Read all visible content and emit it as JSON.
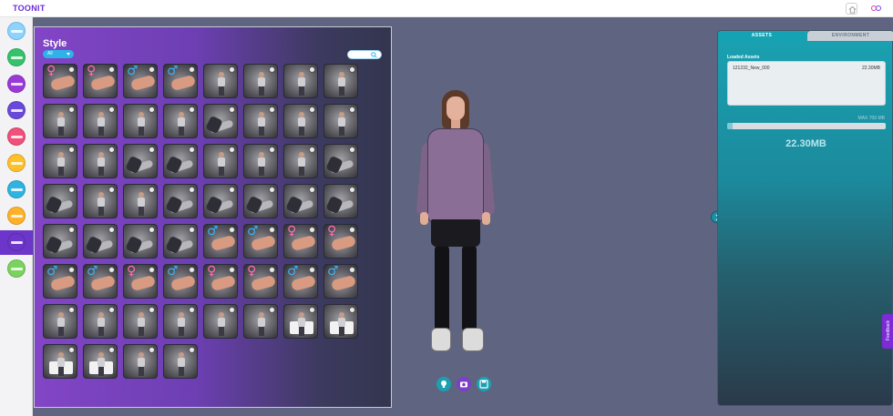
{
  "app": {
    "logo_text": "TOONIT"
  },
  "sidebar": {
    "items": [
      {
        "name": "sidebar-item-1",
        "color": "#8ad4ff"
      },
      {
        "name": "sidebar-item-2",
        "color": "#36c26a"
      },
      {
        "name": "sidebar-item-3",
        "color": "#9a3ad6"
      },
      {
        "name": "sidebar-item-4",
        "color": "#6a48d9"
      },
      {
        "name": "sidebar-item-5",
        "color": "#f0507a"
      },
      {
        "name": "sidebar-item-6",
        "color": "#ffc02a"
      },
      {
        "name": "sidebar-item-7",
        "color": "#2fb3e0"
      },
      {
        "name": "sidebar-item-8",
        "color": "#ffb229"
      },
      {
        "name": "sidebar-item-9",
        "color": "#6b36c9",
        "active": true
      },
      {
        "name": "sidebar-item-10",
        "color": "#7ad35e"
      }
    ]
  },
  "style_panel": {
    "title": "Style",
    "filter": {
      "selected": "All"
    },
    "search": {
      "placeholder": ""
    },
    "thumbnails": [
      "gender-f-phone",
      "gender-f-hand",
      "gender-m-hand",
      "gender-m-phone",
      "pose",
      "pose",
      "pose",
      "pose",
      "pose",
      "pose",
      "pose",
      "pose",
      "lying",
      "pose",
      "pose",
      "pose",
      "pose",
      "pose",
      "lying",
      "lying",
      "pose",
      "pose",
      "pose",
      "lying",
      "lying",
      "pose",
      "pose",
      "lying",
      "lying",
      "lying",
      "lying",
      "lying",
      "lying",
      "lying",
      "lying",
      "lying",
      "gender-m-hand",
      "gender-m-hand",
      "gender-f-hand",
      "gender-f-hand",
      "gender-m-hand",
      "gender-m-hand",
      "gender-f-hand",
      "gender-m-hand",
      "gender-f-hand",
      "gender-f-hand",
      "gender-m-hand",
      "gender-m-hand",
      "pose",
      "pose",
      "pose",
      "pose",
      "pose",
      "pose",
      "chair",
      "chair",
      "chair",
      "chair",
      "pose",
      "pose"
    ]
  },
  "tools": [
    {
      "name": "bulb-icon",
      "color": "#1ba0b2"
    },
    {
      "name": "camera-icon",
      "color": "#7b3fc8"
    },
    {
      "name": "save-icon",
      "color": "#1ba0b2"
    }
  ],
  "right_panel": {
    "tabs": {
      "assets": "ASSETS",
      "environment": "ENVIRONMENT"
    },
    "loaded_label": "Loaded Assets",
    "asset": {
      "name": "121232_New_000",
      "size": "22.30MB"
    },
    "max_label": "MAX 700 MB",
    "progress_fraction": 0.032,
    "total": "22.30MB"
  },
  "feedback_label": "Feedback"
}
